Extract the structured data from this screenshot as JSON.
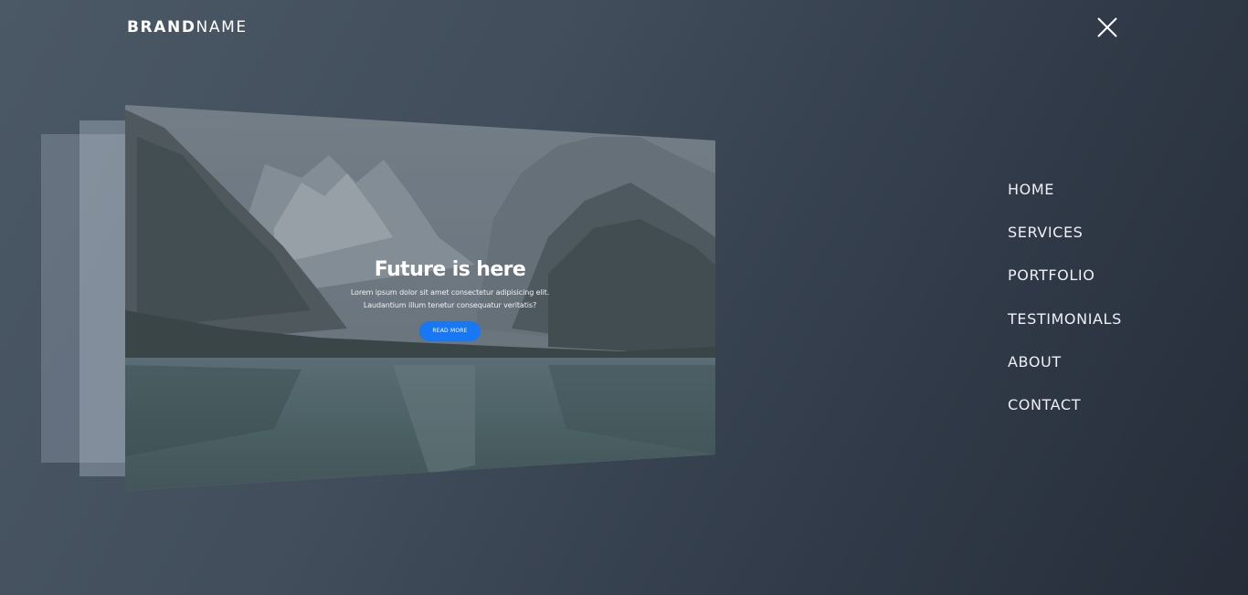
{
  "header": {
    "brand_bold": "BRAND",
    "brand_light": "NAME"
  },
  "slide": {
    "title": "Future is here",
    "text_line1": "Lorem ipsum dolor sit amet consectetur adipisicing elit.",
    "text_line2": "Laudantium illum tenetur consequatur veritatis?",
    "button_label": "READ MORE"
  },
  "menu": {
    "items": [
      {
        "label": "HOME"
      },
      {
        "label": "SERVICES"
      },
      {
        "label": "PORTFOLIO"
      },
      {
        "label": "TESTIMONIALS"
      },
      {
        "label": "ABOUT"
      },
      {
        "label": "CONTACT"
      }
    ]
  },
  "colors": {
    "accent": "#1877f2",
    "background": "#3b4654",
    "text": "#ffffff"
  },
  "icons": {
    "close": "close-icon"
  }
}
